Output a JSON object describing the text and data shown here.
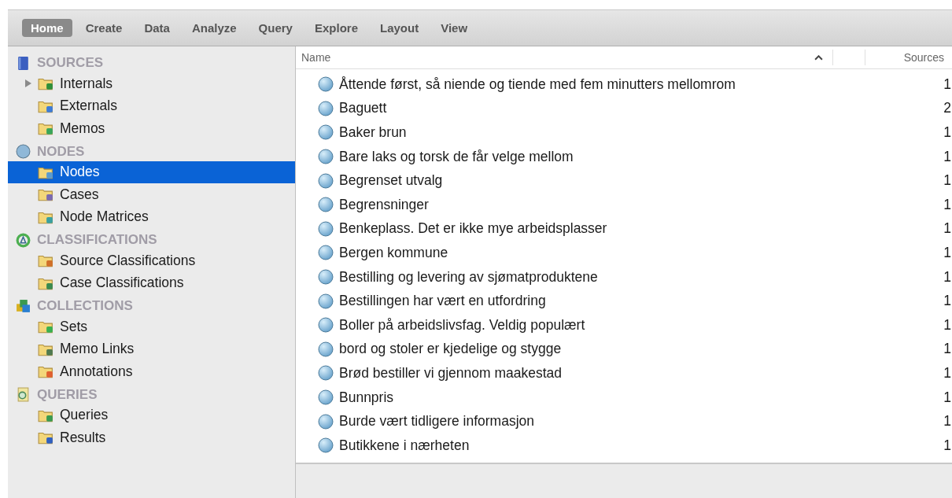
{
  "tabs": [
    {
      "label": "Home",
      "selected": true
    },
    {
      "label": "Create",
      "selected": false
    },
    {
      "label": "Data",
      "selected": false
    },
    {
      "label": "Analyze",
      "selected": false
    },
    {
      "label": "Query",
      "selected": false
    },
    {
      "label": "Explore",
      "selected": false
    },
    {
      "label": "Layout",
      "selected": false
    },
    {
      "label": "View",
      "selected": false
    }
  ],
  "sidebar": {
    "sections": [
      {
        "title": "SOURCES",
        "items": [
          {
            "label": "Internals",
            "selected": false,
            "expanded": false
          },
          {
            "label": "Externals",
            "selected": false
          },
          {
            "label": "Memos",
            "selected": false
          }
        ]
      },
      {
        "title": "NODES",
        "items": [
          {
            "label": "Nodes",
            "selected": true
          },
          {
            "label": "Cases",
            "selected": false
          },
          {
            "label": "Node Matrices",
            "selected": false
          }
        ]
      },
      {
        "title": "CLASSIFICATIONS",
        "items": [
          {
            "label": "Source Classifications",
            "selected": false
          },
          {
            "label": "Case Classifications",
            "selected": false
          }
        ]
      },
      {
        "title": "COLLECTIONS",
        "items": [
          {
            "label": "Sets",
            "selected": false
          },
          {
            "label": "Memo Links",
            "selected": false
          },
          {
            "label": "Annotations",
            "selected": false
          }
        ]
      },
      {
        "title": "QUERIES",
        "items": [
          {
            "label": "Queries",
            "selected": false
          },
          {
            "label": "Results",
            "selected": false
          }
        ]
      }
    ]
  },
  "table": {
    "columns": [
      {
        "label": "Name",
        "sorted": true
      },
      {
        "label": "Sources",
        "sorted": false
      }
    ],
    "rows": [
      {
        "name": "Åttende først, så niende og tiende med fem minutters mellomrom",
        "sources": "1"
      },
      {
        "name": "Baguett",
        "sources": "2"
      },
      {
        "name": "Baker brun",
        "sources": "1"
      },
      {
        "name": "Bare laks og torsk de får velge mellom",
        "sources": "1"
      },
      {
        "name": "Begrenset utvalg",
        "sources": "1"
      },
      {
        "name": "Begrensninger",
        "sources": "1"
      },
      {
        "name": "Benkeplass. Det er ikke mye arbeidsplasser",
        "sources": "1"
      },
      {
        "name": "Bergen kommune",
        "sources": "1"
      },
      {
        "name": "Bestilling og levering av sjømatproduktene",
        "sources": "1"
      },
      {
        "name": "Bestillingen har vært en utfordring",
        "sources": "1"
      },
      {
        "name": "Boller på arbeidslivsfag. Veldig populært",
        "sources": "1"
      },
      {
        "name": "bord og stoler er kjedelige og stygge",
        "sources": "1"
      },
      {
        "name": "Brød bestiller vi gjennom maakestad",
        "sources": "1"
      },
      {
        "name": "Bunnpris",
        "sources": "1"
      },
      {
        "name": "Burde vært tidligere informasjon",
        "sources": "1"
      },
      {
        "name": "Butikkene i nærheten",
        "sources": "1"
      }
    ]
  }
}
